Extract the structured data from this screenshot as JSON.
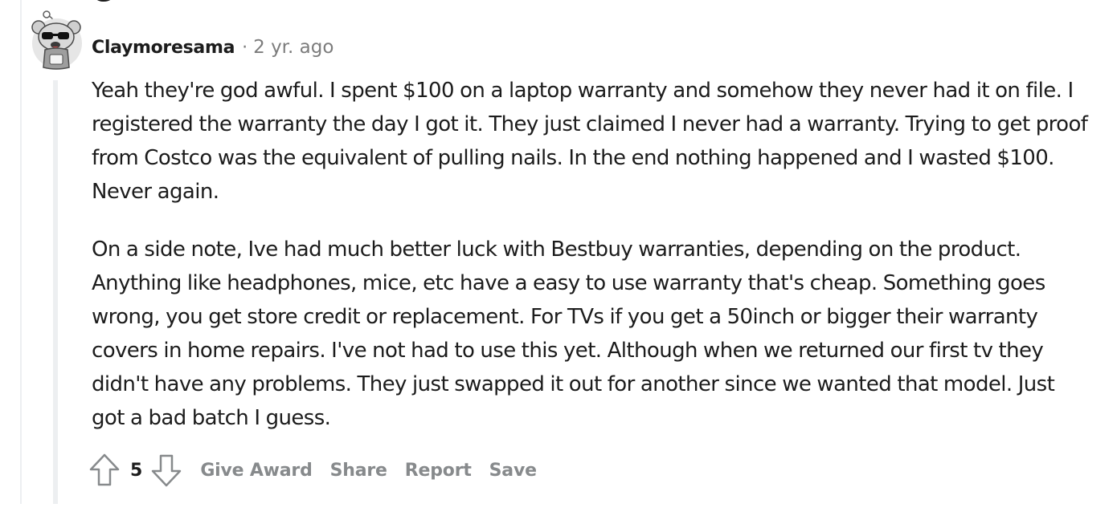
{
  "comment": {
    "author": "Claymoresama",
    "separator": "·",
    "timestamp": "2 yr. ago",
    "paragraphs": [
      "Yeah they're god awful. I spent $100 on a laptop warranty and somehow they never had it on file. I registered the warranty the day I got it. They just claimed I never had a warranty. Trying to get proof from Costco was the equivalent of pulling nails. In the end nothing happened and I wasted $100. Never again.",
      "On a side note, Ive had much better luck with Bestbuy warranties, depending on the product. Anything like headphones, mice, etc have a easy to use warranty that's cheap. Something goes wrong, you get store credit or replacement. For TVs if you get a 50inch or bigger their warranty covers in home repairs. I've not had to use this yet. Although when we returned our first tv they didn't have any problems. They just swapped it out for another since we wanted that model. Just got a bad batch I guess."
    ]
  },
  "actions": {
    "upvote_icon": "arrow-up-outline-icon",
    "vote_count": "5",
    "downvote_icon": "arrow-down-outline-icon",
    "give_award": "Give Award",
    "share": "Share",
    "report": "Report",
    "save": "Save"
  },
  "avatar": {
    "icon": "snoo-avatar-with-sunglasses"
  },
  "colors": {
    "text": "#1c1c1c",
    "meta": "#7c7c7c",
    "action": "#878a8c",
    "thread_line": "#edeff1"
  }
}
